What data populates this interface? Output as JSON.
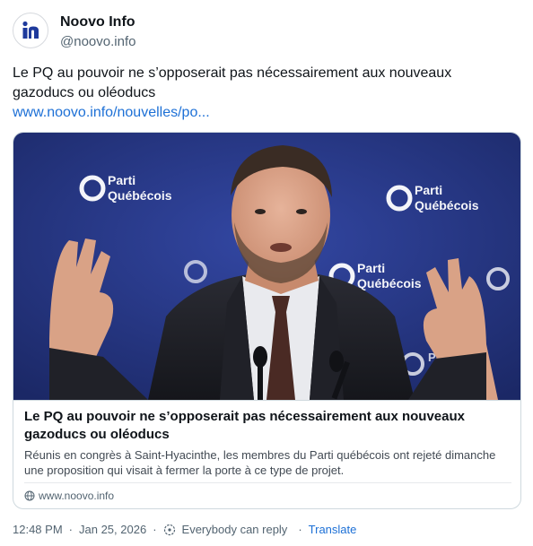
{
  "author": {
    "name": "Noovo Info",
    "handle": "@noovo.info",
    "avatar_letter": "n",
    "avatar_color": "#1e3a9c"
  },
  "post": {
    "text": "Le PQ au pouvoir ne s’opposerait pas nécessairement aux nouveaux gazoducs ou oléoducs",
    "link_text": "www.noovo.info/nouvelles/po..."
  },
  "card": {
    "image_signs": [
      "Parti",
      "Québécois"
    ],
    "title": "Le PQ au pouvoir ne s’opposerait pas nécessairement aux nouveaux gazoducs ou oléoducs",
    "description": "Réunis en congrès à Saint-Hyacinthe, les membres du Parti québécois ont rejeté dimanche une proposition qui visait à fermer la porte à ce type de projet.",
    "domain": "www.noovo.info",
    "domain_icon": "globe-icon"
  },
  "footer": {
    "time": "12:48 PM",
    "date": "Jan 25, 2026",
    "separator": "·",
    "reply_setting": "Everybody can reply",
    "reply_icon": "reply-audience-icon",
    "translate_label": "Translate"
  },
  "colors": {
    "link": "#1d70d6",
    "backdrop": "#26357f",
    "text_secondary": "#536471"
  }
}
